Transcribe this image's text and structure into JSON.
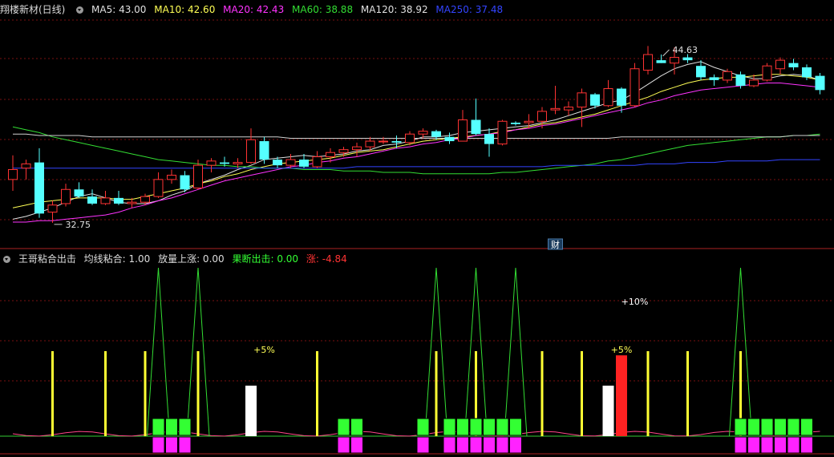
{
  "main_header": {
    "title": "翔楼新材(日线)",
    "ma5": {
      "label": "MA5: 43.00",
      "color": "#e0e0e0"
    },
    "ma10": {
      "label": "MA10: 42.60",
      "color": "#ffff55"
    },
    "ma20": {
      "label": "MA20: 42.43",
      "color": "#ff33ff"
    },
    "ma60": {
      "label": "MA60: 38.88",
      "color": "#33dd33"
    },
    "ma120": {
      "label": "MA120: 38.92",
      "color": "#e0e0e0"
    },
    "ma250": {
      "label": "MA250: 37.48",
      "color": "#3344ff"
    }
  },
  "indicator_header": {
    "name": "王哥粘合出击",
    "param1": "均线粘合: 1.00",
    "param2": "放量上涨: 0.00",
    "param3": {
      "label": "果断出击: 0.00",
      "color": "#33ff33"
    },
    "param4": {
      "label": "涨: -4.84",
      "color": "#ff3333"
    }
  },
  "chart_data": [
    {
      "type": "candlestick",
      "title": "翔楼新材(日线)",
      "ylim": [
        31.5,
        47.2
      ],
      "annotations": [
        {
          "text": "44.63",
          "kind": "high",
          "index": 49
        },
        {
          "text": "32.75",
          "kind": "low",
          "index": 3
        },
        {
          "text": "财",
          "kind": "event-marker",
          "index": 41
        }
      ],
      "candles": [
        {
          "o": 35.8,
          "h": 37.5,
          "l": 35.0,
          "c": 36.5
        },
        {
          "o": 36.6,
          "h": 37.2,
          "l": 35.8,
          "c": 36.9
        },
        {
          "o": 37.0,
          "h": 38.0,
          "l": 33.1,
          "c": 33.4
        },
        {
          "o": 33.5,
          "h": 34.3,
          "l": 32.75,
          "c": 34.0
        },
        {
          "o": 34.1,
          "h": 35.5,
          "l": 33.9,
          "c": 35.1
        },
        {
          "o": 35.1,
          "h": 35.6,
          "l": 34.5,
          "c": 34.6
        },
        {
          "o": 34.6,
          "h": 35.1,
          "l": 34.0,
          "c": 34.1
        },
        {
          "o": 34.1,
          "h": 35.0,
          "l": 34.0,
          "c": 34.5
        },
        {
          "o": 34.5,
          "h": 35.0,
          "l": 34.0,
          "c": 34.1
        },
        {
          "o": 34.1,
          "h": 34.5,
          "l": 33.8,
          "c": 34.2
        },
        {
          "o": 34.2,
          "h": 34.8,
          "l": 34.0,
          "c": 34.6
        },
        {
          "o": 34.6,
          "h": 36.3,
          "l": 34.5,
          "c": 35.8
        },
        {
          "o": 35.8,
          "h": 36.5,
          "l": 35.5,
          "c": 36.1
        },
        {
          "o": 36.1,
          "h": 36.4,
          "l": 34.9,
          "c": 35.1
        },
        {
          "o": 35.2,
          "h": 37.2,
          "l": 35.1,
          "c": 36.8
        },
        {
          "o": 36.8,
          "h": 37.3,
          "l": 36.3,
          "c": 37.1
        },
        {
          "o": 37.0,
          "h": 37.4,
          "l": 36.7,
          "c": 36.9
        },
        {
          "o": 36.9,
          "h": 37.3,
          "l": 36.6,
          "c": 37.0
        },
        {
          "o": 37.0,
          "h": 39.4,
          "l": 36.9,
          "c": 38.6
        },
        {
          "o": 38.5,
          "h": 38.8,
          "l": 36.9,
          "c": 37.2
        },
        {
          "o": 37.2,
          "h": 37.4,
          "l": 36.6,
          "c": 36.8
        },
        {
          "o": 36.8,
          "h": 37.6,
          "l": 36.6,
          "c": 37.2
        },
        {
          "o": 37.2,
          "h": 37.6,
          "l": 36.6,
          "c": 36.7
        },
        {
          "o": 36.7,
          "h": 37.8,
          "l": 36.6,
          "c": 37.4
        },
        {
          "o": 37.4,
          "h": 38.0,
          "l": 37.0,
          "c": 37.7
        },
        {
          "o": 37.7,
          "h": 38.1,
          "l": 37.4,
          "c": 37.9
        },
        {
          "o": 37.9,
          "h": 38.4,
          "l": 37.4,
          "c": 38.1
        },
        {
          "o": 38.1,
          "h": 38.8,
          "l": 37.8,
          "c": 38.5
        },
        {
          "o": 38.5,
          "h": 38.8,
          "l": 38.3,
          "c": 38.5
        },
        {
          "o": 38.5,
          "h": 38.9,
          "l": 38.0,
          "c": 38.4
        },
        {
          "o": 38.4,
          "h": 39.2,
          "l": 38.2,
          "c": 39.0
        },
        {
          "o": 39.0,
          "h": 39.4,
          "l": 38.7,
          "c": 39.2
        },
        {
          "o": 39.2,
          "h": 39.3,
          "l": 38.6,
          "c": 38.8
        },
        {
          "o": 38.8,
          "h": 39.1,
          "l": 38.3,
          "c": 38.5
        },
        {
          "o": 38.5,
          "h": 40.7,
          "l": 38.5,
          "c": 40.0
        },
        {
          "o": 40.0,
          "h": 41.5,
          "l": 38.9,
          "c": 39.0
        },
        {
          "o": 39.0,
          "h": 39.4,
          "l": 37.4,
          "c": 38.3
        },
        {
          "o": 38.3,
          "h": 40.0,
          "l": 38.2,
          "c": 39.9
        },
        {
          "o": 39.8,
          "h": 39.9,
          "l": 39.6,
          "c": 39.7
        },
        {
          "o": 39.8,
          "h": 40.4,
          "l": 39.4,
          "c": 39.9
        },
        {
          "o": 39.9,
          "h": 40.9,
          "l": 39.4,
          "c": 40.6
        },
        {
          "o": 40.7,
          "h": 42.4,
          "l": 40.4,
          "c": 40.8
        },
        {
          "o": 40.7,
          "h": 41.3,
          "l": 40.3,
          "c": 40.9
        },
        {
          "o": 40.9,
          "h": 42.2,
          "l": 39.5,
          "c": 41.9
        },
        {
          "o": 41.8,
          "h": 41.9,
          "l": 40.8,
          "c": 41.0
        },
        {
          "o": 41.0,
          "h": 42.8,
          "l": 40.9,
          "c": 42.2
        },
        {
          "o": 42.2,
          "h": 42.3,
          "l": 40.5,
          "c": 41.0
        },
        {
          "o": 41.0,
          "h": 44.0,
          "l": 40.9,
          "c": 43.6
        },
        {
          "o": 43.5,
          "h": 45.2,
          "l": 43.2,
          "c": 44.6
        },
        {
          "o": 44.2,
          "h": 44.6,
          "l": 44.0,
          "c": 44.0
        },
        {
          "o": 44.0,
          "h": 45.1,
          "l": 43.2,
          "c": 44.4
        },
        {
          "o": 44.4,
          "h": 44.63,
          "l": 44.0,
          "c": 44.2
        },
        {
          "o": 43.8,
          "h": 44.2,
          "l": 42.8,
          "c": 43.0
        },
        {
          "o": 43.0,
          "h": 43.2,
          "l": 42.4,
          "c": 42.8
        },
        {
          "o": 42.8,
          "h": 43.6,
          "l": 42.6,
          "c": 43.4
        },
        {
          "o": 43.2,
          "h": 43.4,
          "l": 42.2,
          "c": 42.4
        },
        {
          "o": 42.4,
          "h": 43.2,
          "l": 42.3,
          "c": 42.8
        },
        {
          "o": 42.8,
          "h": 44.0,
          "l": 42.7,
          "c": 43.8
        },
        {
          "o": 43.6,
          "h": 44.4,
          "l": 43.2,
          "c": 44.2
        },
        {
          "o": 44.0,
          "h": 44.3,
          "l": 43.5,
          "c": 43.7
        },
        {
          "o": 43.7,
          "h": 43.9,
          "l": 42.8,
          "c": 43.0
        },
        {
          "o": 43.1,
          "h": 43.3,
          "l": 41.8,
          "c": 42.1
        }
      ],
      "ma_series": [
        {
          "name": "MA5",
          "values": [
            33.0,
            33.2,
            33.5,
            33.8,
            34.2,
            34.6,
            34.8,
            34.5,
            34.2,
            34.1,
            34.1,
            34.3,
            34.7,
            35.0,
            35.5,
            35.8,
            36.1,
            36.5,
            36.8,
            37.2,
            37.3,
            37.4,
            37.5,
            37.4,
            37.5,
            37.6,
            37.8,
            37.9,
            38.2,
            38.3,
            38.5,
            38.8,
            38.8,
            38.9,
            39.1,
            39.2,
            39.3,
            39.4,
            39.5,
            39.6,
            39.8,
            40.0,
            40.3,
            40.6,
            40.9,
            41.2,
            41.4,
            41.9,
            42.5,
            43.1,
            43.6,
            43.9,
            44.1,
            43.7,
            43.4,
            43.1,
            42.9,
            42.9,
            43.1,
            43.2,
            43.1,
            42.8
          ]
        },
        {
          "name": "MA10",
          "values": [
            33.8,
            34.0,
            34.2,
            34.3,
            34.4,
            34.5,
            34.5,
            34.5,
            34.4,
            34.4,
            34.6,
            34.8,
            35.0,
            35.2,
            35.5,
            35.7,
            36.0,
            36.2,
            36.5,
            36.7,
            36.9,
            37.0,
            37.1,
            37.2,
            37.3,
            37.5,
            37.7,
            37.8,
            37.9,
            38.1,
            38.3,
            38.5,
            38.6,
            38.7,
            38.8,
            38.9,
            39.0,
            39.2,
            39.3,
            39.5,
            39.7,
            39.8,
            40.0,
            40.2,
            40.4,
            40.7,
            41.0,
            41.3,
            41.6,
            42.0,
            42.3,
            42.6,
            42.8,
            42.9,
            43.0,
            43.0,
            43.1,
            43.2,
            43.2,
            43.1,
            43.0,
            42.8
          ]
        },
        {
          "name": "MA20",
          "values": [
            32.8,
            32.8,
            32.9,
            32.9,
            33.0,
            33.1,
            33.2,
            33.3,
            33.5,
            33.8,
            34.0,
            34.3,
            34.5,
            34.8,
            35.1,
            35.4,
            35.7,
            35.9,
            36.1,
            36.3,
            36.5,
            36.7,
            36.8,
            37.0,
            37.1,
            37.3,
            37.4,
            37.6,
            37.8,
            38.0,
            38.1,
            38.3,
            38.4,
            38.6,
            38.7,
            38.9,
            39.0,
            39.1,
            39.3,
            39.4,
            39.6,
            39.7,
            39.9,
            40.1,
            40.3,
            40.5,
            40.7,
            40.9,
            41.2,
            41.4,
            41.7,
            41.9,
            42.1,
            42.2,
            42.3,
            42.4,
            42.5,
            42.6,
            42.6,
            42.5,
            42.4,
            42.3
          ]
        },
        {
          "name": "MA60",
          "values": [
            39.5,
            39.3,
            39.1,
            38.8,
            38.6,
            38.4,
            38.2,
            38.0,
            37.8,
            37.6,
            37.4,
            37.2,
            37.1,
            37.0,
            36.9,
            36.8,
            36.8,
            36.7,
            36.7,
            36.6,
            36.6,
            36.6,
            36.5,
            36.5,
            36.5,
            36.4,
            36.4,
            36.4,
            36.3,
            36.3,
            36.3,
            36.2,
            36.2,
            36.2,
            36.2,
            36.2,
            36.2,
            36.3,
            36.3,
            36.4,
            36.5,
            36.6,
            36.7,
            36.8,
            36.9,
            37.1,
            37.2,
            37.4,
            37.6,
            37.8,
            38.0,
            38.2,
            38.3,
            38.4,
            38.5,
            38.6,
            38.7,
            38.8,
            38.8,
            38.9,
            38.9,
            39.0
          ]
        },
        {
          "name": "MA120",
          "values": [
            39.0,
            39.0,
            38.9,
            38.9,
            38.9,
            38.9,
            38.8,
            38.8,
            38.8,
            38.8,
            38.8,
            38.8,
            38.8,
            38.8,
            38.8,
            38.8,
            38.8,
            38.8,
            38.8,
            38.8,
            38.8,
            38.7,
            38.7,
            38.7,
            38.7,
            38.7,
            38.7,
            38.7,
            38.7,
            38.7,
            38.7,
            38.7,
            38.7,
            38.7,
            38.7,
            38.7,
            38.7,
            38.7,
            38.7,
            38.7,
            38.7,
            38.7,
            38.7,
            38.7,
            38.7,
            38.7,
            38.8,
            38.8,
            38.8,
            38.8,
            38.8,
            38.8,
            38.8,
            38.8,
            38.8,
            38.8,
            38.8,
            38.8,
            38.8,
            38.9,
            38.9,
            38.9
          ]
        },
        {
          "name": "MA250",
          "values": [
            36.6,
            36.6,
            36.6,
            36.6,
            36.6,
            36.6,
            36.6,
            36.6,
            36.6,
            36.6,
            36.6,
            36.6,
            36.6,
            36.6,
            36.6,
            36.6,
            36.6,
            36.6,
            36.6,
            36.6,
            36.6,
            36.6,
            36.6,
            36.6,
            36.6,
            36.6,
            36.7,
            36.7,
            36.7,
            36.7,
            36.7,
            36.7,
            36.7,
            36.7,
            36.7,
            36.7,
            36.7,
            36.7,
            36.7,
            36.7,
            36.7,
            36.8,
            36.8,
            36.8,
            36.8,
            36.8,
            36.8,
            36.8,
            36.9,
            36.9,
            36.9,
            37.0,
            37.0,
            37.0,
            37.1,
            37.1,
            37.1,
            37.1,
            37.2,
            37.2,
            37.2,
            37.2
          ]
        }
      ]
    },
    {
      "type": "indicator",
      "title": "王哥粘合出击",
      "labels": [
        {
          "text": "+5%",
          "color": "#ffff55",
          "index": 19
        },
        {
          "text": "+10%",
          "color": "#ffffff",
          "index": 47
        },
        {
          "text": "+5%",
          "color": "#ffff55",
          "index": 46
        }
      ],
      "yellow_lines": [
        3,
        7,
        10,
        14,
        23,
        32,
        35,
        40,
        43,
        48,
        51,
        55
      ],
      "green_peaks": [
        11,
        14,
        32,
        35,
        38,
        55
      ],
      "green_blocks": [
        11,
        12,
        13,
        25,
        26,
        31,
        33,
        34,
        35,
        36,
        37,
        38,
        55,
        56,
        57,
        58,
        59,
        60
      ],
      "magenta_blocks": [
        11,
        12,
        13,
        25,
        26,
        31,
        33,
        34,
        35,
        36,
        37,
        38,
        55,
        56,
        57,
        58,
        59,
        60
      ],
      "white_bars": [
        {
          "index": 18,
          "value": 0.5
        },
        {
          "index": 45,
          "value": 0.5
        }
      ],
      "red_bars": [
        {
          "index": 46,
          "value": 0.8
        }
      ]
    }
  ]
}
